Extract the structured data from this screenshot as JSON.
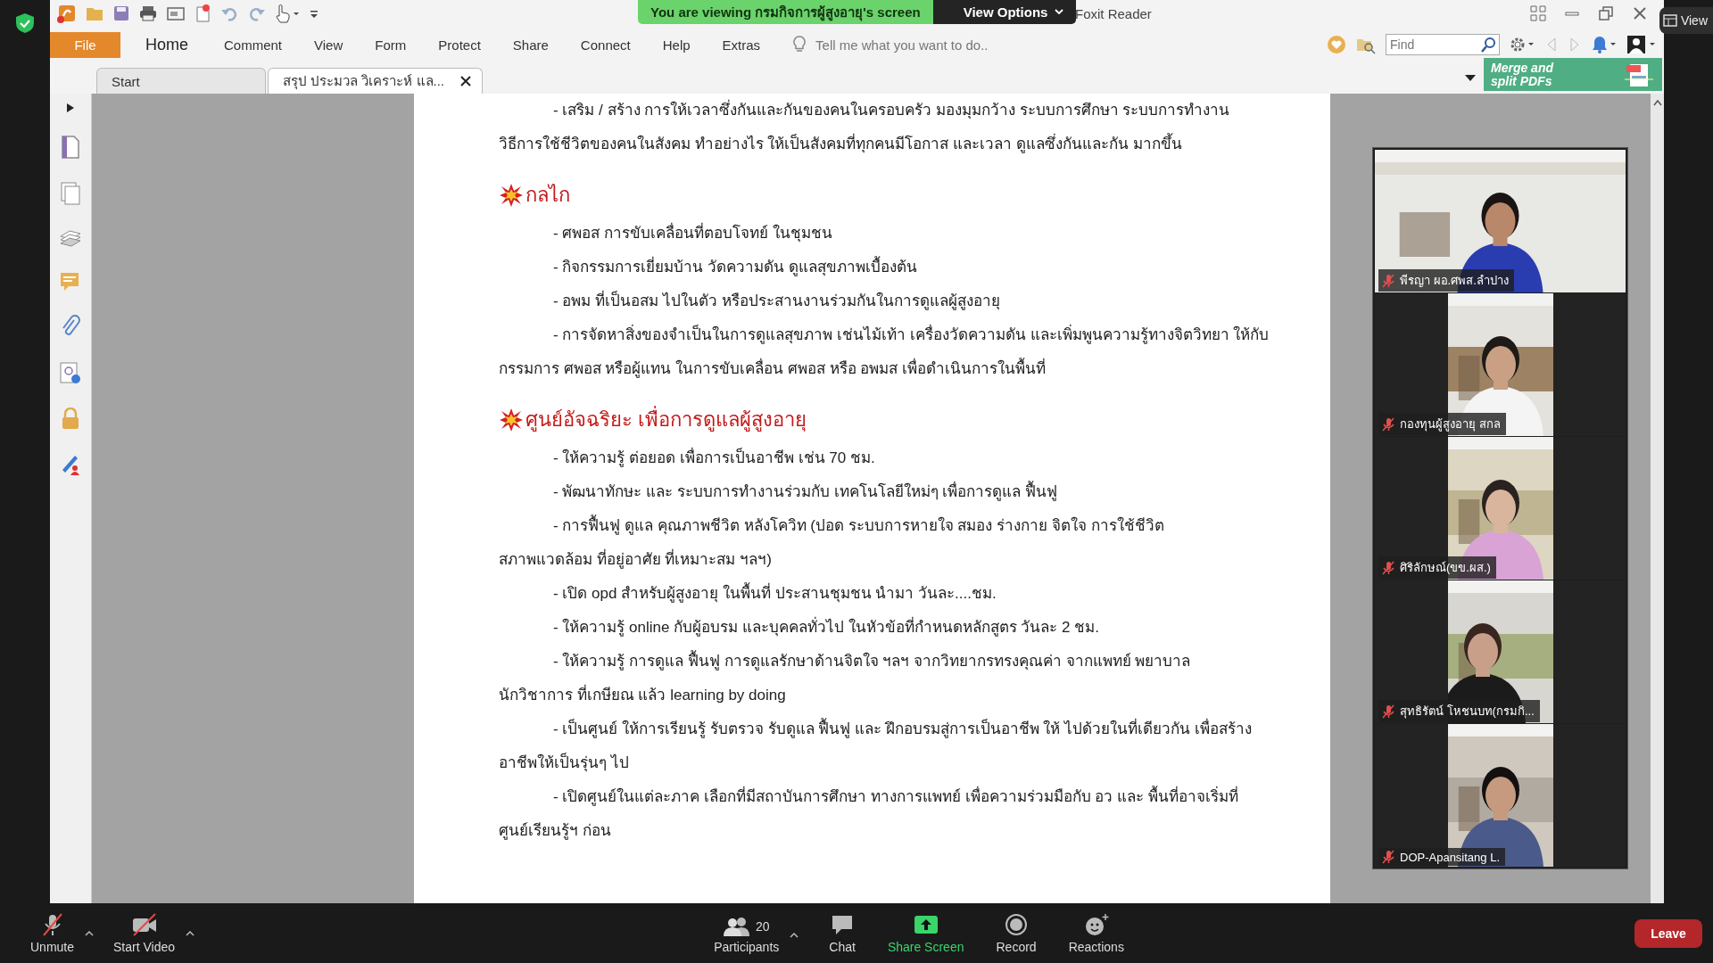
{
  "share_banner": {
    "text": "You are viewing กรมกิจการผู้สูงอายุ's screen",
    "button": "View Options"
  },
  "view_button": "View",
  "reader": {
    "title": "Foxit Reader",
    "file_tab": "File",
    "menu": [
      {
        "label": "Home",
        "selected": true
      },
      {
        "label": "Comment",
        "selected": false
      },
      {
        "label": "View",
        "selected": false
      },
      {
        "label": "Form",
        "selected": false
      },
      {
        "label": "Protect",
        "selected": false
      },
      {
        "label": "Share",
        "selected": false
      },
      {
        "label": "Connect",
        "selected": false
      },
      {
        "label": "Help",
        "selected": false
      },
      {
        "label": "Extras",
        "selected": false
      }
    ],
    "tell_me": "Tell me what you want to do..",
    "find_placeholder": "Find",
    "ad_lines": [
      "Merge and",
      "split PDFs"
    ],
    "doc_tabs": [
      {
        "label": "Start",
        "selected": false,
        "closable": false
      },
      {
        "label": "สรุป ประมวล วิเคราะห์ แล...",
        "selected": true,
        "closable": true
      }
    ]
  },
  "document": {
    "lines": [
      {
        "kind": "bullet",
        "text": "- เสริม / สร้าง การให้เวลาซึ่งกันและกันของคนในครอบครัว มองมุมกว้าง ระบบการศึกษา ระบบการทำงาน"
      },
      {
        "kind": "cont",
        "text": "วิธีการใช้ชีวิตของคนในสังคม ทำอย่างไร ให้เป็นสังคมที่ทุกคนมีโอกาส และเวลา ดูแลซึ่งกันและกัน มากขึ้น"
      },
      {
        "kind": "heading",
        "text": "กลไก"
      },
      {
        "kind": "bullet",
        "text": "- ศพอส การขับเคลื่อนที่ตอบโจทย์ ในชุมชน"
      },
      {
        "kind": "bullet",
        "text": "- กิจกรรมการเยี่ยมบ้าน วัดความดัน ดูแลสุขภาพเบื้องต้น"
      },
      {
        "kind": "bullet",
        "text": "- อพม ที่เป็นอสม ไปในตัว หรือประสานงานร่วมกันในการดูแลผู้สูงอายุ"
      },
      {
        "kind": "bullet",
        "text": "- การจัดหาสิ่งของจำเป็นในการดูแลสุขภาพ เช่นไม้เท้า เครื่องวัดความดัน และเพิ่มพูนความรู้ทางจิตวิทยา ให้กับ"
      },
      {
        "kind": "cont",
        "text": "กรรมการ ศพอส หรือผู้แทน ในการขับเคลื่อน ศพอส หรือ อพมส เพื่อดำเนินการในพื้นที่"
      },
      {
        "kind": "heading",
        "text": "ศูนย์อัจฉริยะ เพื่อการดูแลผู้สูงอายุ"
      },
      {
        "kind": "bullet",
        "text": "- ให้ความรู้ ต่อยอด เพื่อการเป็นอาชีพ เช่น 70 ชม."
      },
      {
        "kind": "bullet",
        "text": "- พัฒนาทักษะ และ ระบบการทำงานร่วมกับ เทคโนโลยีใหม่ๆ เพื่อการดูแล ฟื้นฟู"
      },
      {
        "kind": "bullet",
        "text": "- การฟื้นฟู ดูแล คุณภาพชีวิต หลังโควิท (ปอด ระบบการหายใจ สมอง ร่างกาย จิตใจ การใช้ชีวิต"
      },
      {
        "kind": "cont",
        "text": "สภาพแวดล้อม ที่อยู่อาศัย ที่เหมาะสม ฯลฯ)"
      },
      {
        "kind": "bullet",
        "text": "- เปิด opd สำหรับผู้สูงอายุ ในพื้นที่ ประสานชุมชน นำมา วันละ....ชม."
      },
      {
        "kind": "bullet",
        "text": "- ให้ความรู้ online กับผู้อบรม และบุคคลทั่วไป ในหัวข้อที่กำหนดหลักสูตร วันละ 2 ชม."
      },
      {
        "kind": "bullet",
        "text": "- ให้ความรู้ การดูแล ฟื้นฟู การดูแลรักษาด้านจิตใจ ฯลฯ จากวิทยากรทรงคุณค่า จากแพทย์ พยาบาล"
      },
      {
        "kind": "cont",
        "text": "นักวิชาการ ที่เกษียณ แล้ว learning by doing"
      },
      {
        "kind": "bullet",
        "text": "- เป็นศูนย์ ให้การเรียนรู้ รับตรวจ รับดูแล ฟื้นฟู และ ฝึกอบรมสู่การเป็นอาชีพ ให้ ไปด้วยในที่เดียวกัน เพื่อสร้าง"
      },
      {
        "kind": "cont",
        "text": "อาชีพให้เป็นรุ่นๆ ไป"
      },
      {
        "kind": "bullet",
        "text": "- เปิดศูนย์ในแต่ละภาค เลือกที่มีสถาบันการศึกษา ทางการแพทย์ เพื่อความร่วมมือกับ อว และ พื้นที่อาจเริ่มที่"
      },
      {
        "kind": "cont",
        "text": "ศูนย์เรียนรู้ฯ ก่อน"
      }
    ]
  },
  "videos": [
    {
      "name": "พีรญา ผอ.ศพส.ลำปาง",
      "muted": true
    },
    {
      "name": "กองทุนผู้สูงอายุ สกล",
      "muted": true
    },
    {
      "name": "ศิริลักษณ์(ขข.ผส.)",
      "muted": true
    },
    {
      "name": "สุทธิรัตน์ โหชนบท(กรมกิ...",
      "muted": true
    },
    {
      "name": "DOP-Apansitang L.",
      "muted": true
    }
  ],
  "meeting_toolbar": {
    "left": [
      {
        "kind": "mic",
        "label": "Unmute"
      },
      {
        "kind": "video",
        "label": "Start Video"
      }
    ],
    "center": [
      {
        "kind": "participants",
        "label": "Participants",
        "count": "20"
      },
      {
        "kind": "chat",
        "label": "Chat"
      },
      {
        "kind": "share",
        "label": "Share Screen"
      },
      {
        "kind": "record",
        "label": "Record"
      },
      {
        "kind": "reactions",
        "label": "Reactions"
      }
    ],
    "leave": "Leave"
  }
}
